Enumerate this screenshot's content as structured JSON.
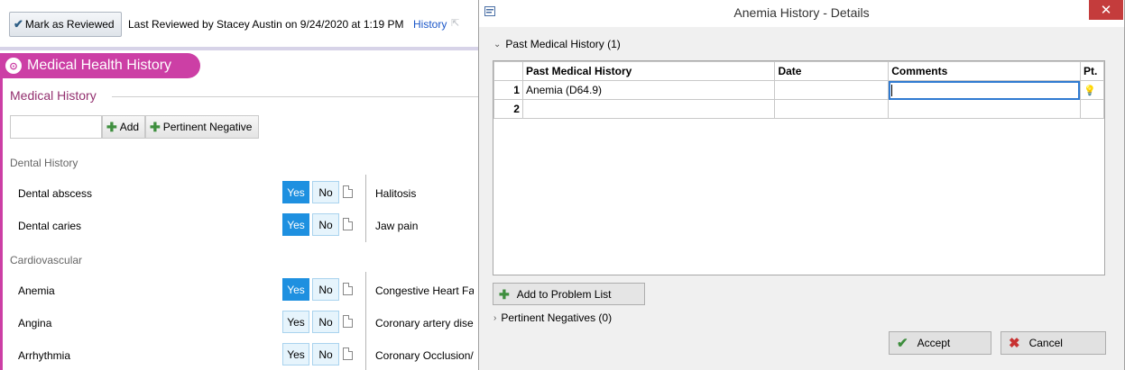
{
  "background": {
    "mark_reviewed_label": "Mark as Reviewed",
    "last_reviewed_text": "Last Reviewed by Stacey Austin on 9/24/2020 at 1:19 PM",
    "history_link": "History",
    "section_tab_title": "Medical Health History",
    "medical_history_title": "Medical History",
    "add_label": "Add",
    "pertinent_negative_label": "Pertinent Negative",
    "groups": [
      {
        "title": "Dental History",
        "rows": [
          {
            "left": "Dental abscess",
            "yes": "Yes",
            "no": "No",
            "yes_selected": true,
            "right": "Halitosis"
          },
          {
            "left": "Dental caries",
            "yes": "Yes",
            "no": "No",
            "yes_selected": true,
            "right": "Jaw pain"
          }
        ]
      },
      {
        "title": "Cardiovascular",
        "rows": [
          {
            "left": "Anemia",
            "yes": "Yes",
            "no": "No",
            "yes_selected": true,
            "right": "Congestive Heart Fa"
          },
          {
            "left": "Angina",
            "yes": "Yes",
            "no": "No",
            "yes_selected": false,
            "right": "Coronary artery dise"
          },
          {
            "left": "Arrhythmia",
            "yes": "Yes",
            "no": "No",
            "yes_selected": false,
            "right": "Coronary Occlusion/"
          }
        ]
      }
    ]
  },
  "dialog": {
    "title": "Anemia History - Details",
    "close_glyph": "✕",
    "pmh_section": "Past Medical History (1)",
    "columns": [
      "Past Medical History",
      "Date",
      "Comments",
      "Pt."
    ],
    "rows": [
      {
        "num": "1",
        "history": "Anemia (D64.9)",
        "date": "",
        "comments": ""
      },
      {
        "num": "2",
        "history": "",
        "date": "",
        "comments": ""
      }
    ],
    "add_problem_label": "Add to Problem List",
    "pertinent_negatives": "Pertinent Negatives (0)",
    "accept_label": "Accept",
    "cancel_label": "Cancel"
  },
  "colors": {
    "accent_pink": "#cc3fa5",
    "yes_selected": "#1e90e0",
    "link_blue": "#1a56c8"
  }
}
